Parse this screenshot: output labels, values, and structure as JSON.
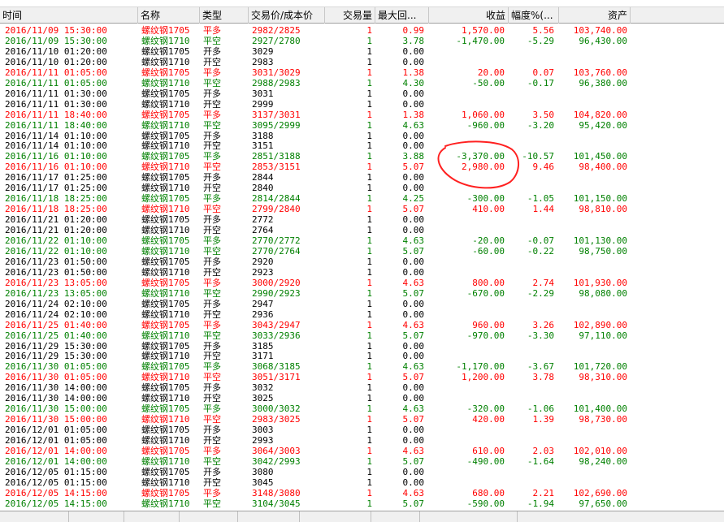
{
  "columns": [
    "时间",
    "名称",
    "类型",
    "交易价/成本价",
    "交易量",
    "最大回...",
    "收益",
    "幅度%(...",
    "资产"
  ],
  "colors": {
    "red": "#ff0000",
    "green": "#008000",
    "black": "#000000"
  },
  "rows": [
    {
      "color": "red",
      "time": "2016/11/09 15:30:00",
      "name": "螺纹钢1705",
      "type": "平多",
      "price": "2982/2825",
      "qty": "1",
      "maxdd": "0.99",
      "profit": "1,570.00",
      "pct": "5.56",
      "asset": "103,740.00"
    },
    {
      "color": "green",
      "time": "2016/11/09 15:30:00",
      "name": "螺纹钢1710",
      "type": "平空",
      "price": "2927/2780",
      "qty": "1",
      "maxdd": "3.78",
      "profit": "-1,470.00",
      "pct": "-5.29",
      "asset": "96,430.00"
    },
    {
      "color": "black",
      "time": "2016/11/10 01:20:00",
      "name": "螺纹钢1705",
      "type": "开多",
      "price": "3029",
      "qty": "1",
      "maxdd": "0.00",
      "profit": "",
      "pct": "",
      "asset": ""
    },
    {
      "color": "black",
      "time": "2016/11/10 01:20:00",
      "name": "螺纹钢1710",
      "type": "开空",
      "price": "2983",
      "qty": "1",
      "maxdd": "0.00",
      "profit": "",
      "pct": "",
      "asset": ""
    },
    {
      "color": "red",
      "time": "2016/11/11 01:05:00",
      "name": "螺纹钢1705",
      "type": "平多",
      "price": "3031/3029",
      "qty": "1",
      "maxdd": "1.38",
      "profit": "20.00",
      "pct": "0.07",
      "asset": "103,760.00"
    },
    {
      "color": "green",
      "time": "2016/11/11 01:05:00",
      "name": "螺纹钢1710",
      "type": "平空",
      "price": "2988/2983",
      "qty": "1",
      "maxdd": "4.30",
      "profit": "-50.00",
      "pct": "-0.17",
      "asset": "96,380.00"
    },
    {
      "color": "black",
      "time": "2016/11/11 01:30:00",
      "name": "螺纹钢1705",
      "type": "开多",
      "price": "3031",
      "qty": "1",
      "maxdd": "0.00",
      "profit": "",
      "pct": "",
      "asset": ""
    },
    {
      "color": "black",
      "time": "2016/11/11 01:30:00",
      "name": "螺纹钢1710",
      "type": "开空",
      "price": "2999",
      "qty": "1",
      "maxdd": "0.00",
      "profit": "",
      "pct": "",
      "asset": ""
    },
    {
      "color": "red",
      "time": "2016/11/11 18:40:00",
      "name": "螺纹钢1705",
      "type": "平多",
      "price": "3137/3031",
      "qty": "1",
      "maxdd": "1.38",
      "profit": "1,060.00",
      "pct": "3.50",
      "asset": "104,820.00"
    },
    {
      "color": "green",
      "time": "2016/11/11 18:40:00",
      "name": "螺纹钢1710",
      "type": "平空",
      "price": "3095/2999",
      "qty": "1",
      "maxdd": "4.63",
      "profit": "-960.00",
      "pct": "-3.20",
      "asset": "95,420.00"
    },
    {
      "color": "black",
      "time": "2016/11/14 01:10:00",
      "name": "螺纹钢1705",
      "type": "开多",
      "price": "3188",
      "qty": "1",
      "maxdd": "0.00",
      "profit": "",
      "pct": "",
      "asset": ""
    },
    {
      "color": "black",
      "time": "2016/11/14 01:10:00",
      "name": "螺纹钢1710",
      "type": "开空",
      "price": "3151",
      "qty": "1",
      "maxdd": "0.00",
      "profit": "",
      "pct": "",
      "asset": ""
    },
    {
      "color": "green",
      "time": "2016/11/16 01:10:00",
      "name": "螺纹钢1705",
      "type": "平多",
      "price": "2851/3188",
      "qty": "1",
      "maxdd": "3.88",
      "profit": "-3,370.00",
      "pct": "-10.57",
      "asset": "101,450.00"
    },
    {
      "color": "red",
      "time": "2016/11/16 01:10:00",
      "name": "螺纹钢1710",
      "type": "平空",
      "price": "2853/3151",
      "qty": "1",
      "maxdd": "5.07",
      "profit": "2,980.00",
      "pct": "9.46",
      "asset": "98,400.00"
    },
    {
      "color": "black",
      "time": "2016/11/17 01:25:00",
      "name": "螺纹钢1705",
      "type": "开多",
      "price": "2844",
      "qty": "1",
      "maxdd": "0.00",
      "profit": "",
      "pct": "",
      "asset": ""
    },
    {
      "color": "black",
      "time": "2016/11/17 01:25:00",
      "name": "螺纹钢1710",
      "type": "开空",
      "price": "2840",
      "qty": "1",
      "maxdd": "0.00",
      "profit": "",
      "pct": "",
      "asset": ""
    },
    {
      "color": "green",
      "time": "2016/11/18 18:25:00",
      "name": "螺纹钢1705",
      "type": "平多",
      "price": "2814/2844",
      "qty": "1",
      "maxdd": "4.25",
      "profit": "-300.00",
      "pct": "-1.05",
      "asset": "101,150.00"
    },
    {
      "color": "red",
      "time": "2016/11/18 18:25:00",
      "name": "螺纹钢1710",
      "type": "平空",
      "price": "2799/2840",
      "qty": "1",
      "maxdd": "5.07",
      "profit": "410.00",
      "pct": "1.44",
      "asset": "98,810.00"
    },
    {
      "color": "black",
      "time": "2016/11/21 01:20:00",
      "name": "螺纹钢1705",
      "type": "开多",
      "price": "2772",
      "qty": "1",
      "maxdd": "0.00",
      "profit": "",
      "pct": "",
      "asset": ""
    },
    {
      "color": "black",
      "time": "2016/11/21 01:20:00",
      "name": "螺纹钢1710",
      "type": "开空",
      "price": "2764",
      "qty": "1",
      "maxdd": "0.00",
      "profit": "",
      "pct": "",
      "asset": ""
    },
    {
      "color": "green",
      "time": "2016/11/22 01:10:00",
      "name": "螺纹钢1705",
      "type": "平多",
      "price": "2770/2772",
      "qty": "1",
      "maxdd": "4.63",
      "profit": "-20.00",
      "pct": "-0.07",
      "asset": "101,130.00"
    },
    {
      "color": "green",
      "time": "2016/11/22 01:10:00",
      "name": "螺纹钢1710",
      "type": "平空",
      "price": "2770/2764",
      "qty": "1",
      "maxdd": "5.07",
      "profit": "-60.00",
      "pct": "-0.22",
      "asset": "98,750.00"
    },
    {
      "color": "black",
      "time": "2016/11/23 01:50:00",
      "name": "螺纹钢1705",
      "type": "开多",
      "price": "2920",
      "qty": "1",
      "maxdd": "0.00",
      "profit": "",
      "pct": "",
      "asset": ""
    },
    {
      "color": "black",
      "time": "2016/11/23 01:50:00",
      "name": "螺纹钢1710",
      "type": "开空",
      "price": "2923",
      "qty": "1",
      "maxdd": "0.00",
      "profit": "",
      "pct": "",
      "asset": ""
    },
    {
      "color": "red",
      "time": "2016/11/23 13:05:00",
      "name": "螺纹钢1705",
      "type": "平多",
      "price": "3000/2920",
      "qty": "1",
      "maxdd": "4.63",
      "profit": "800.00",
      "pct": "2.74",
      "asset": "101,930.00"
    },
    {
      "color": "green",
      "time": "2016/11/23 13:05:00",
      "name": "螺纹钢1710",
      "type": "平空",
      "price": "2990/2923",
      "qty": "1",
      "maxdd": "5.07",
      "profit": "-670.00",
      "pct": "-2.29",
      "asset": "98,080.00"
    },
    {
      "color": "black",
      "time": "2016/11/24 02:10:00",
      "name": "螺纹钢1705",
      "type": "开多",
      "price": "2947",
      "qty": "1",
      "maxdd": "0.00",
      "profit": "",
      "pct": "",
      "asset": ""
    },
    {
      "color": "black",
      "time": "2016/11/24 02:10:00",
      "name": "螺纹钢1710",
      "type": "开空",
      "price": "2936",
      "qty": "1",
      "maxdd": "0.00",
      "profit": "",
      "pct": "",
      "asset": ""
    },
    {
      "color": "red",
      "time": "2016/11/25 01:40:00",
      "name": "螺纹钢1705",
      "type": "平多",
      "price": "3043/2947",
      "qty": "1",
      "maxdd": "4.63",
      "profit": "960.00",
      "pct": "3.26",
      "asset": "102,890.00"
    },
    {
      "color": "green",
      "time": "2016/11/25 01:40:00",
      "name": "螺纹钢1710",
      "type": "平空",
      "price": "3033/2936",
      "qty": "1",
      "maxdd": "5.07",
      "profit": "-970.00",
      "pct": "-3.30",
      "asset": "97,110.00"
    },
    {
      "color": "black",
      "time": "2016/11/29 15:30:00",
      "name": "螺纹钢1705",
      "type": "开多",
      "price": "3185",
      "qty": "1",
      "maxdd": "0.00",
      "profit": "",
      "pct": "",
      "asset": ""
    },
    {
      "color": "black",
      "time": "2016/11/29 15:30:00",
      "name": "螺纹钢1710",
      "type": "开空",
      "price": "3171",
      "qty": "1",
      "maxdd": "0.00",
      "profit": "",
      "pct": "",
      "asset": ""
    },
    {
      "color": "green",
      "time": "2016/11/30 01:05:00",
      "name": "螺纹钢1705",
      "type": "平多",
      "price": "3068/3185",
      "qty": "1",
      "maxdd": "4.63",
      "profit": "-1,170.00",
      "pct": "-3.67",
      "asset": "101,720.00"
    },
    {
      "color": "red",
      "time": "2016/11/30 01:05:00",
      "name": "螺纹钢1710",
      "type": "平空",
      "price": "3051/3171",
      "qty": "1",
      "maxdd": "5.07",
      "profit": "1,200.00",
      "pct": "3.78",
      "asset": "98,310.00"
    },
    {
      "color": "black",
      "time": "2016/11/30 14:00:00",
      "name": "螺纹钢1705",
      "type": "开多",
      "price": "3032",
      "qty": "1",
      "maxdd": "0.00",
      "profit": "",
      "pct": "",
      "asset": ""
    },
    {
      "color": "black",
      "time": "2016/11/30 14:00:00",
      "name": "螺纹钢1710",
      "type": "开空",
      "price": "3025",
      "qty": "1",
      "maxdd": "0.00",
      "profit": "",
      "pct": "",
      "asset": ""
    },
    {
      "color": "green",
      "time": "2016/11/30 15:00:00",
      "name": "螺纹钢1705",
      "type": "平多",
      "price": "3000/3032",
      "qty": "1",
      "maxdd": "4.63",
      "profit": "-320.00",
      "pct": "-1.06",
      "asset": "101,400.00"
    },
    {
      "color": "red",
      "time": "2016/11/30 15:00:00",
      "name": "螺纹钢1710",
      "type": "平空",
      "price": "2983/3025",
      "qty": "1",
      "maxdd": "5.07",
      "profit": "420.00",
      "pct": "1.39",
      "asset": "98,730.00"
    },
    {
      "color": "black",
      "time": "2016/12/01 01:05:00",
      "name": "螺纹钢1705",
      "type": "开多",
      "price": "3003",
      "qty": "1",
      "maxdd": "0.00",
      "profit": "",
      "pct": "",
      "asset": ""
    },
    {
      "color": "black",
      "time": "2016/12/01 01:05:00",
      "name": "螺纹钢1710",
      "type": "开空",
      "price": "2993",
      "qty": "1",
      "maxdd": "0.00",
      "profit": "",
      "pct": "",
      "asset": ""
    },
    {
      "color": "red",
      "time": "2016/12/01 14:00:00",
      "name": "螺纹钢1705",
      "type": "平多",
      "price": "3064/3003",
      "qty": "1",
      "maxdd": "4.63",
      "profit": "610.00",
      "pct": "2.03",
      "asset": "102,010.00"
    },
    {
      "color": "green",
      "time": "2016/12/01 14:00:00",
      "name": "螺纹钢1710",
      "type": "平空",
      "price": "3042/2993",
      "qty": "1",
      "maxdd": "5.07",
      "profit": "-490.00",
      "pct": "-1.64",
      "asset": "98,240.00"
    },
    {
      "color": "black",
      "time": "2016/12/05 01:15:00",
      "name": "螺纹钢1705",
      "type": "开多",
      "price": "3080",
      "qty": "1",
      "maxdd": "0.00",
      "profit": "",
      "pct": "",
      "asset": ""
    },
    {
      "color": "black",
      "time": "2016/12/05 01:15:00",
      "name": "螺纹钢1710",
      "type": "开空",
      "price": "3045",
      "qty": "1",
      "maxdd": "0.00",
      "profit": "",
      "pct": "",
      "asset": ""
    },
    {
      "color": "red",
      "time": "2016/12/05 14:15:00",
      "name": "螺纹钢1705",
      "type": "平多",
      "price": "3148/3080",
      "qty": "1",
      "maxdd": "4.63",
      "profit": "680.00",
      "pct": "2.21",
      "asset": "102,690.00"
    },
    {
      "color": "green",
      "time": "2016/12/05 14:15:00",
      "name": "螺纹钢1710",
      "type": "平空",
      "price": "3104/3045",
      "qty": "1",
      "maxdd": "5.07",
      "profit": "-590.00",
      "pct": "-1.94",
      "asset": "97,650.00"
    }
  ]
}
